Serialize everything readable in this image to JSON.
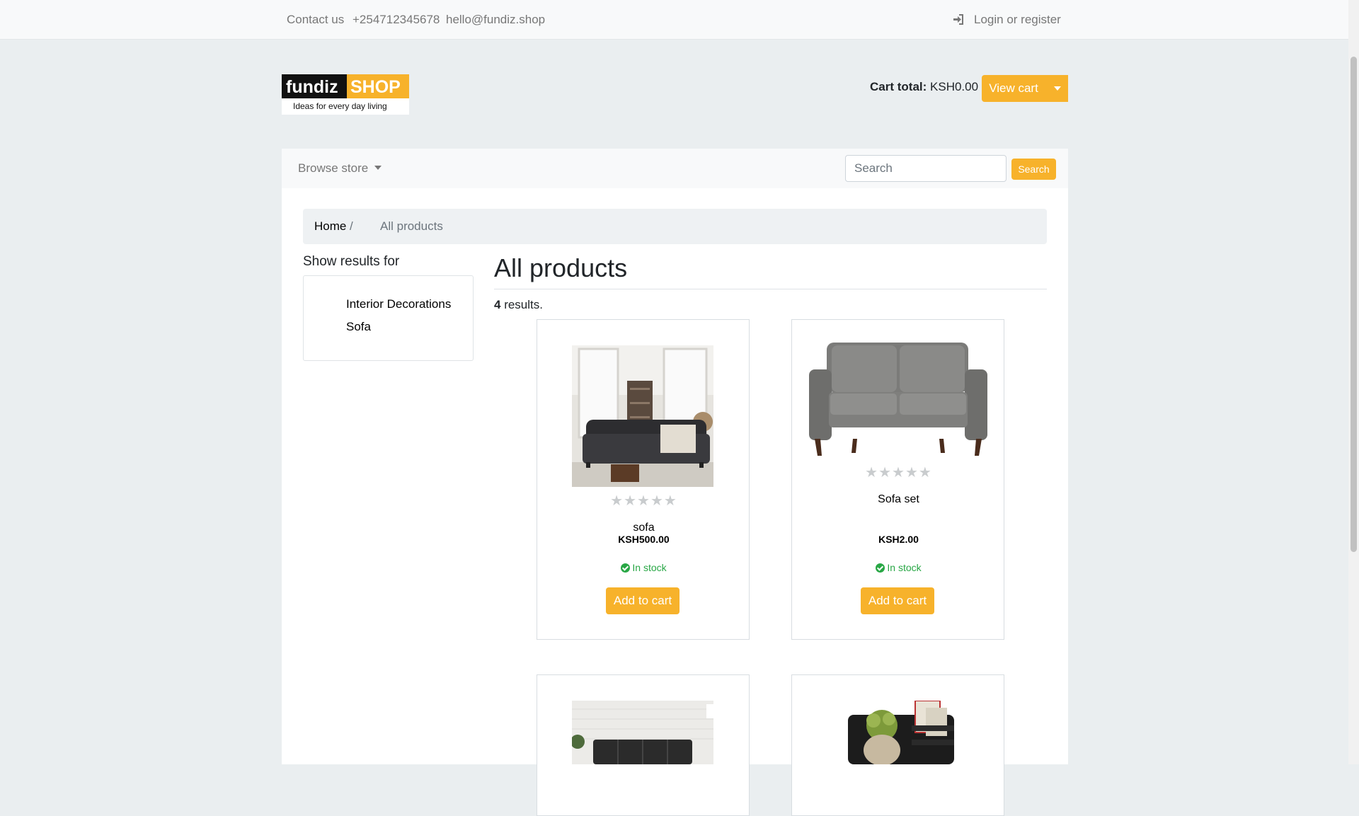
{
  "topbar": {
    "contact_label": "Contact us",
    "phone": "+254712345678",
    "email": "hello@fundiz.shop",
    "login_label": "Login or register"
  },
  "header": {
    "logo_text_left": "fundiz",
    "logo_text_right": "SHOP",
    "logo_tagline": "Ideas for every day living",
    "cart_total_label": "Cart total:",
    "cart_total_value": "KSH0.00",
    "view_cart_label": "View cart"
  },
  "nav": {
    "browse_label": "Browse store",
    "search_placeholder": "Search",
    "search_button": "Search"
  },
  "breadcrumb": {
    "home": "Home",
    "separator": "/",
    "current": "All products"
  },
  "facets": {
    "title": "Show results for",
    "items": [
      "Interior Decorations",
      "Sofa"
    ]
  },
  "main": {
    "title": "All products",
    "result_count": "4",
    "result_suffix": " results."
  },
  "products": [
    {
      "name": "sofa",
      "price": "KSH500.00",
      "stock": "In stock",
      "button": "Add to cart",
      "rating": 0
    },
    {
      "name": "Sofa set",
      "price": "KSH2.00",
      "stock": "In stock",
      "button": "Add to cart",
      "rating": 0
    }
  ],
  "colors": {
    "accent": "#f7b22b",
    "in_stock": "#28a745",
    "page_bg": "#eaeef0"
  }
}
